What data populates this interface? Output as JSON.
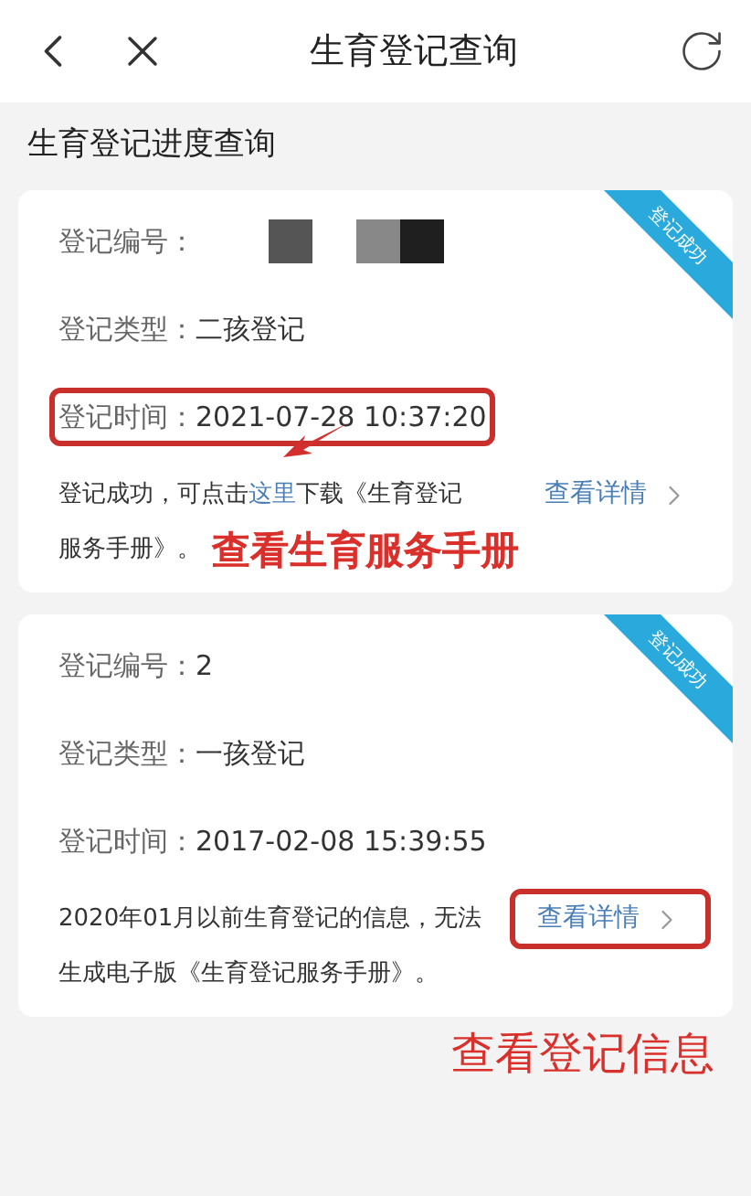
{
  "header": {
    "title": "生育登记查询"
  },
  "section_title": "生育登记进度查询",
  "cards": [
    {
      "status": "登记成功",
      "fields": [
        {
          "label": "登记编号：",
          "kind": "redacted",
          "highlighted": false
        },
        {
          "label": "登记类型：",
          "kind": "text",
          "value": "二孩登记",
          "highlighted": false
        },
        {
          "label": "登记时间：",
          "kind": "text",
          "value": "2021-07-28 10:37:20",
          "highlighted": true
        }
      ],
      "note_lines": [
        {
          "before": "登记成功，可点击",
          "link": "这里",
          "after": "下载《生育登记"
        },
        {
          "before": "服务手册》。"
        }
      ],
      "details_link": {
        "text": "查看详情",
        "highlighted": false
      },
      "arrow": true,
      "caption": {
        "text": "查看生育服务手册",
        "kind": "inline"
      }
    },
    {
      "status": "登记成功",
      "fields": [
        {
          "label": "登记编号：",
          "kind": "text",
          "value": "2",
          "highlighted": false
        },
        {
          "label": "登记类型：",
          "kind": "text",
          "value": "一孩登记",
          "highlighted": false
        },
        {
          "label": "登记时间：",
          "kind": "text",
          "value": "2017-02-08 15:39:55",
          "highlighted": false
        }
      ],
      "note_lines": [
        {
          "before": "2020年01月以前生育登记的信息，无法"
        },
        {
          "before": "生成电子版《生育登记服务手册》。"
        }
      ],
      "details_link": {
        "text": "查看详情",
        "highlighted": true
      },
      "arrow": false,
      "caption": {
        "text": "查看登记信息",
        "kind": "below"
      }
    }
  ]
}
